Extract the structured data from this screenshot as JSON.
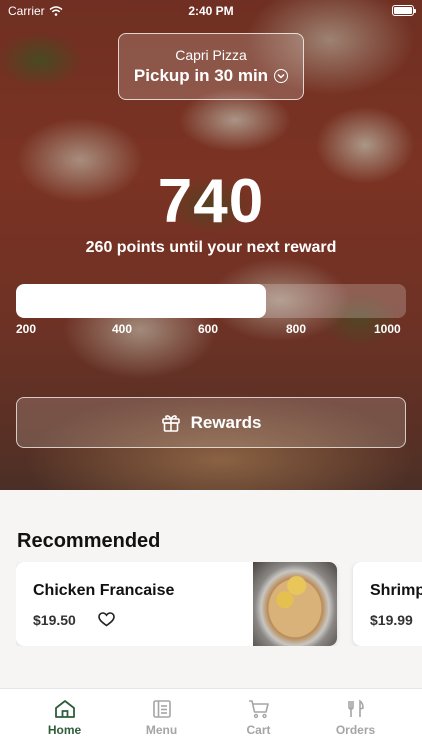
{
  "status_bar": {
    "carrier": "Carrier",
    "time": "2:40 PM"
  },
  "store": {
    "name": "Capri Pizza",
    "pickup": "Pickup in 30 min"
  },
  "rewards": {
    "points": "740",
    "subtitle": "260 points until your next reward",
    "progress_fraction": 0.64,
    "ticks": [
      "200",
      "400",
      "600",
      "800",
      "1000"
    ],
    "button_label": "Rewards"
  },
  "recommended": {
    "title": "Recommended",
    "items": [
      {
        "name": "Chicken Francaise",
        "price": "$19.50"
      },
      {
        "name": "Shrimp",
        "price": "$19.99"
      }
    ]
  },
  "tabs": [
    {
      "label": "Home",
      "icon": "home-icon"
    },
    {
      "label": "Menu",
      "icon": "menu-icon"
    },
    {
      "label": "Cart",
      "icon": "cart-icon"
    },
    {
      "label": "Orders",
      "icon": "orders-icon"
    }
  ],
  "colors": {
    "accent": "#2f5d3a",
    "inactive_tab": "#a5a5a5"
  }
}
